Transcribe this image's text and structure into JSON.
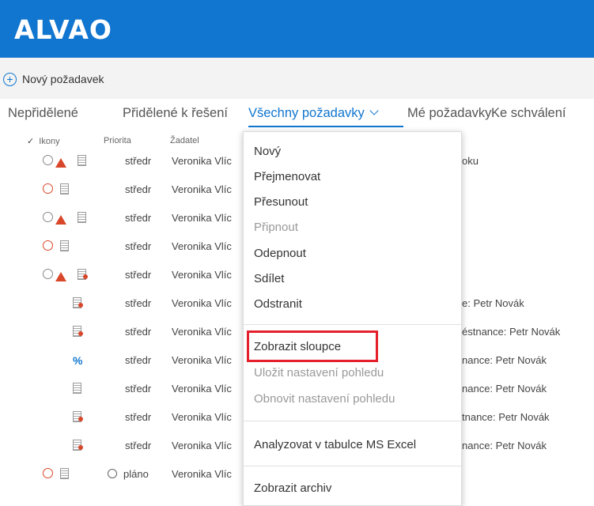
{
  "app": {
    "logo": "ALVAO"
  },
  "actions": {
    "new_request": "Nový požadavek"
  },
  "tabs": [
    {
      "label": "Nepřidělené"
    },
    {
      "label": "Přidělené k řešení"
    },
    {
      "label": "Všechny požadavky"
    },
    {
      "label": "Mé požadavky"
    },
    {
      "label": "Ke schválení"
    }
  ],
  "columns": {
    "check": "✓",
    "icons": "Ikony",
    "priority": "Priorita",
    "requester": "Žadatel"
  },
  "rows": [
    {
      "priority": "středr",
      "requester": "Veronika Vlíc",
      "note": "oku"
    },
    {
      "priority": "středr",
      "requester": "Veronika Vlíc",
      "note": ""
    },
    {
      "priority": "středr",
      "requester": "Veronika Vlíc",
      "note": ""
    },
    {
      "priority": "středr",
      "requester": "Veronika Vlíc",
      "note": ""
    },
    {
      "priority": "středr",
      "requester": "Veronika Vlíc",
      "note": ""
    },
    {
      "priority": "středr",
      "requester": "Veronika Vlíc",
      "note": "e: Petr Novák"
    },
    {
      "priority": "středr",
      "requester": "Veronika Vlíc",
      "note": "éstnance: Petr Novák"
    },
    {
      "priority": "středr",
      "requester": "Veronika Vlíc",
      "note": "nance: Petr Novák"
    },
    {
      "priority": "středr",
      "requester": "Veronika Vlíc",
      "note": "nance: Petr Novák"
    },
    {
      "priority": "středr",
      "requester": "Veronika Vlíc",
      "note": "tnance: Petr Novák"
    },
    {
      "priority": "středr",
      "requester": "Veronika Vlíc",
      "note": "nance: Petr Novák"
    },
    {
      "priority": "pláno",
      "requester": "Veronika Vlíc",
      "note": ""
    }
  ],
  "menu": {
    "new": "Nový",
    "rename": "Přejmenovat",
    "move": "Přesunout",
    "pin": "Připnout",
    "unpin": "Odepnout",
    "share": "Sdílet",
    "delete": "Odstranit",
    "show_columns": "Zobrazit sloupce",
    "save_view": "Uložit nastavení pohledu",
    "restore_view": "Obnovit nastavení pohledu",
    "analyze_excel": "Analyzovat v tabulce MS Excel",
    "show_archive": "Zobrazit archiv"
  },
  "colors": {
    "brand": "#1176cf",
    "highlight": "#e3202b",
    "alert": "#d9472b"
  }
}
